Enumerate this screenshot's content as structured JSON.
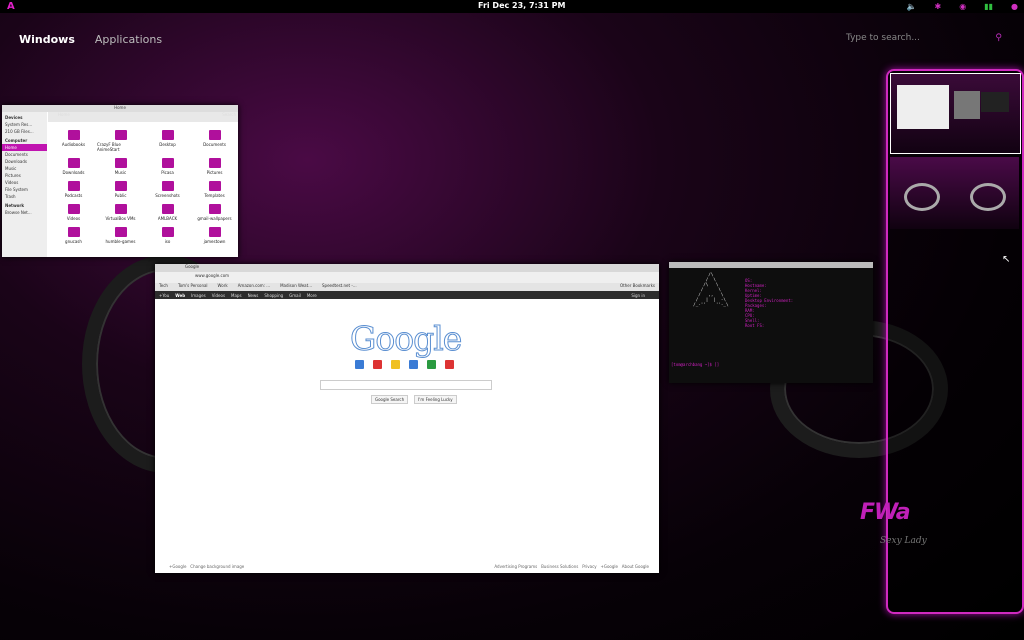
{
  "topbar": {
    "logo": "A",
    "clock": "Fri Dec 23,  7:31 PM",
    "tray": {
      "volume_icon": "speaker-icon",
      "bluetooth_icon": "bluetooth-icon",
      "network_icon": "wifi-icon",
      "battery_icon": "battery-icon",
      "user_icon": "user-icon"
    }
  },
  "overview": {
    "tabs": [
      "Windows",
      "Applications"
    ],
    "search_placeholder": "Type to search..."
  },
  "file_manager": {
    "title": "Home",
    "location": "Home",
    "search_label": "Search",
    "sidebar": {
      "devices_header": "Devices",
      "devices": [
        "System Res...",
        "210 GB Files..."
      ],
      "computer_header": "Computer",
      "computer": [
        "Home",
        "Documents",
        "Downloads",
        "Music",
        "Pictures",
        "Videos",
        "File System",
        "Trash"
      ],
      "network_header": "Network",
      "network": [
        "Browse Net..."
      ]
    },
    "folders": [
      "Audiobooks",
      "CrazyF Blue AnimeStart",
      "Desktop",
      "Documents",
      "Downloads",
      "Music",
      "Picasa",
      "Pictures",
      "Podcasts",
      "Public",
      "Screenshots",
      "Templates",
      "Videos",
      "VirtualBox VMs",
      "AMLBACK",
      "gmail-wallpapers",
      "gnucash",
      "humble-games",
      "iso",
      "jamestown"
    ]
  },
  "browser": {
    "tab_label": "Google",
    "address": "www.google.com",
    "bookmarks": [
      "Tech",
      "Tom's Personal",
      "Work",
      "Amazon.com: ...",
      "Madison Weat...",
      "Speedtest.net -..."
    ],
    "other_bookmarks": "Other Bookmarks",
    "google_bar": [
      "+You",
      "Web",
      "Images",
      "Videos",
      "Maps",
      "News",
      "Shopping",
      "Gmail",
      "More"
    ],
    "sign_in": "Sign in",
    "logo": "Google",
    "buttons": [
      "Google Search",
      "I'm Feeling Lucky"
    ],
    "footer_left": [
      "+Google",
      "Change background image"
    ],
    "footer_right": [
      "Advertising Programs",
      "Business Solutions",
      "Privacy",
      "+Google",
      "About Google"
    ]
  },
  "terminal": {
    "info_labels": [
      "OS:",
      "Hostname:",
      "Kernel:",
      "Uptime:",
      "Desktop Environment:",
      "Packages:",
      "RAM:",
      "CPU:",
      "Shell:",
      "Root FS:"
    ],
    "prompt": "[tom@archbang ~]$ []"
  },
  "branding": {
    "logo_text": "FWa",
    "tagline": "Sexy Lady"
  },
  "colors": {
    "accent": "#d02ac0",
    "background": "#0a020a",
    "battery": "#30c040"
  }
}
